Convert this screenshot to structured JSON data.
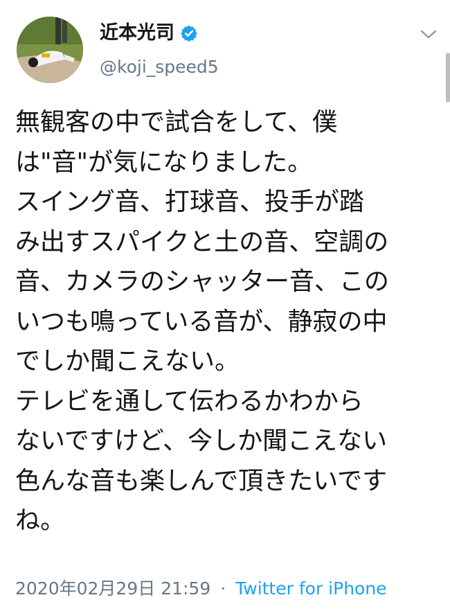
{
  "user": {
    "display_name": "近本光司",
    "handle": "@koji_speed5",
    "verified": true
  },
  "tweet": {
    "lines": [
      "無観客の中で試合をして、僕",
      "は\"音\"が気になりました。",
      "スイング音、打球音、投手が踏",
      "み出すスパイクと土の音、空調の",
      "音、カメラのシャッター音、この",
      "いつも鳴っている音が、静寂の中",
      "でしか聞こえない。",
      "テレビを通して伝わるかわから",
      "ないですけど、今しか聞こえない",
      "色んな音も楽しんで頂きたいです",
      "ね。"
    ]
  },
  "meta": {
    "timestamp": "2020年02月29日 21:59",
    "separator": "·",
    "source": "Twitter for iPhone"
  },
  "icons": {
    "verified": "verified-badge-icon",
    "menu": "chevron-down-icon"
  },
  "colors": {
    "text": "#14171a",
    "secondary": "#657786",
    "link": "#1da1f2"
  }
}
